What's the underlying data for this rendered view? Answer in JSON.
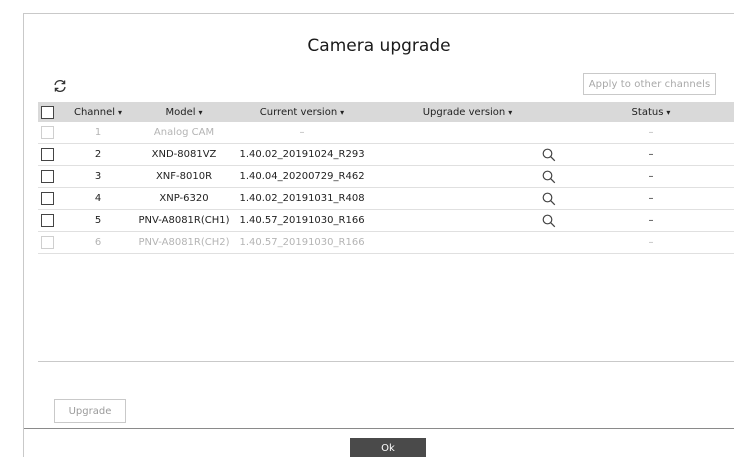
{
  "dialog": {
    "title": "Camera upgrade",
    "refresh_icon": "refresh-icon",
    "apply_button": "Apply to other channels"
  },
  "table": {
    "headers": {
      "channel": "Channel",
      "model": "Model",
      "current_version": "Current version",
      "upgrade_version": "Upgrade version",
      "status": "Status"
    },
    "sort_caret": "▾",
    "rows": [
      {
        "channel": "1",
        "model": "Analog CAM",
        "current_version": "–",
        "upgrade_version": "",
        "status": "–",
        "disabled": true,
        "search": false
      },
      {
        "channel": "2",
        "model": "XND-8081VZ",
        "current_version": "1.40.02_20191024_R293",
        "upgrade_version": "",
        "status": "–",
        "disabled": false,
        "search": true
      },
      {
        "channel": "3",
        "model": "XNF-8010R",
        "current_version": "1.40.04_20200729_R462",
        "upgrade_version": "",
        "status": "–",
        "disabled": false,
        "search": true
      },
      {
        "channel": "4",
        "model": "XNP-6320",
        "current_version": "1.40.02_20191031_R408",
        "upgrade_version": "",
        "status": "–",
        "disabled": false,
        "search": true
      },
      {
        "channel": "5",
        "model": "PNV-A8081R(CH1)",
        "current_version": "1.40.57_20191030_R166",
        "upgrade_version": "",
        "status": "–",
        "disabled": false,
        "search": true
      },
      {
        "channel": "6",
        "model": "PNV-A8081R(CH2)",
        "current_version": "1.40.57_20191030_R166",
        "upgrade_version": "",
        "status": "–",
        "disabled": true,
        "search": false
      }
    ]
  },
  "footer": {
    "upgrade_button": "Upgrade",
    "ok_button": "Ok"
  },
  "colors": {
    "header_bg": "#d9d9d9",
    "ok_bg": "#4a4a4a",
    "disabled_text": "#b4b4b4"
  }
}
